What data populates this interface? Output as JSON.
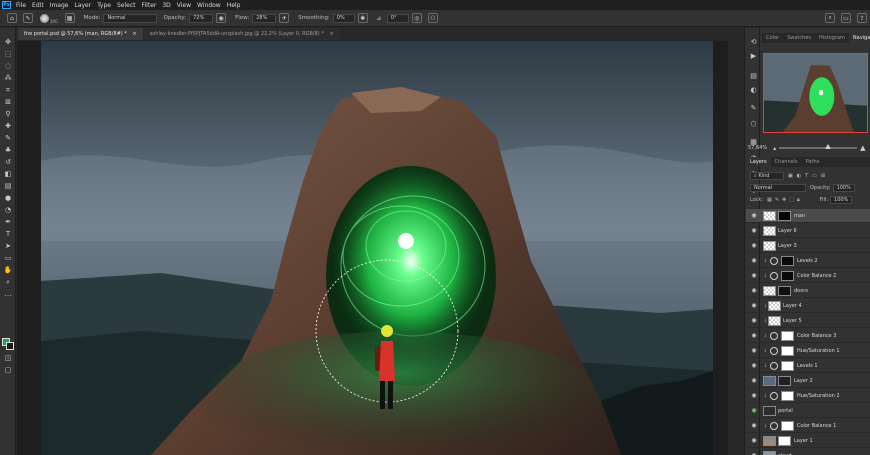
{
  "menubar": {
    "logo": "Ps",
    "items": [
      "File",
      "Edit",
      "Image",
      "Layer",
      "Type",
      "Select",
      "Filter",
      "3D",
      "View",
      "Window",
      "Help"
    ]
  },
  "options": {
    "brush_size": "300",
    "mode_label": "Mode:",
    "mode_value": "Normal",
    "opacity_label": "Opacity:",
    "opacity_value": "72%",
    "flow_label": "Flow:",
    "flow_value": "28%",
    "smoothing_label": "Smoothing:",
    "smoothing_value": "0%",
    "angle_value": "0°"
  },
  "doc_tabs": [
    {
      "label": "the portal.psd @ 57,6% (man, RGB/8#) *"
    },
    {
      "label": "ashley-knedler-PfSPjTA5ddA-unsplash.jpg @ 22,2% (Layer 0, RGB/8) *"
    }
  ],
  "navigator": {
    "tabs": [
      "Color",
      "Swatches",
      "Histogram",
      "Navigator"
    ],
    "zoom": "57,64%"
  },
  "layers_panel": {
    "tabs": [
      "Layers",
      "Channels",
      "Paths"
    ],
    "kind_label": "Kind",
    "blend_mode": "Normal",
    "opacity_label": "Opacity:",
    "opacity_value": "100%",
    "lock_label": "Lock:",
    "fill_label": "Fill:",
    "fill_value": "100%",
    "layers": [
      {
        "name": "man",
        "kind": "pixel-mask"
      },
      {
        "name": "Layer 6",
        "kind": "pixel"
      },
      {
        "name": "Layer 3",
        "kind": "pixel"
      },
      {
        "name": "Levels 2",
        "kind": "adjustment"
      },
      {
        "name": "Color Balance 2",
        "kind": "adjustment"
      },
      {
        "name": "doors",
        "kind": "pixel-mask"
      },
      {
        "name": "Layer 4",
        "kind": "pixel"
      },
      {
        "name": "Layer 5",
        "kind": "pixel"
      },
      {
        "name": "Color Balance 3",
        "kind": "adjustment"
      },
      {
        "name": "Hue/Saturation 1",
        "kind": "adjustment"
      },
      {
        "name": "Levels 1",
        "kind": "adjustment"
      },
      {
        "name": "Layer 2",
        "kind": "pixel-mask"
      },
      {
        "name": "Hue/Saturation 2",
        "kind": "adjustment"
      },
      {
        "name": "portal",
        "kind": "pixel"
      },
      {
        "name": "Color Balance 1",
        "kind": "adjustment"
      },
      {
        "name": "Layer 1",
        "kind": "pixel-mask"
      },
      {
        "name": "cloud",
        "kind": "pixel"
      }
    ]
  },
  "colors": {
    "foreground": "#1ea35a",
    "background": "#1a1a1a",
    "portal_glow": "#39ff6a",
    "selection_accent": "#e0433a"
  }
}
